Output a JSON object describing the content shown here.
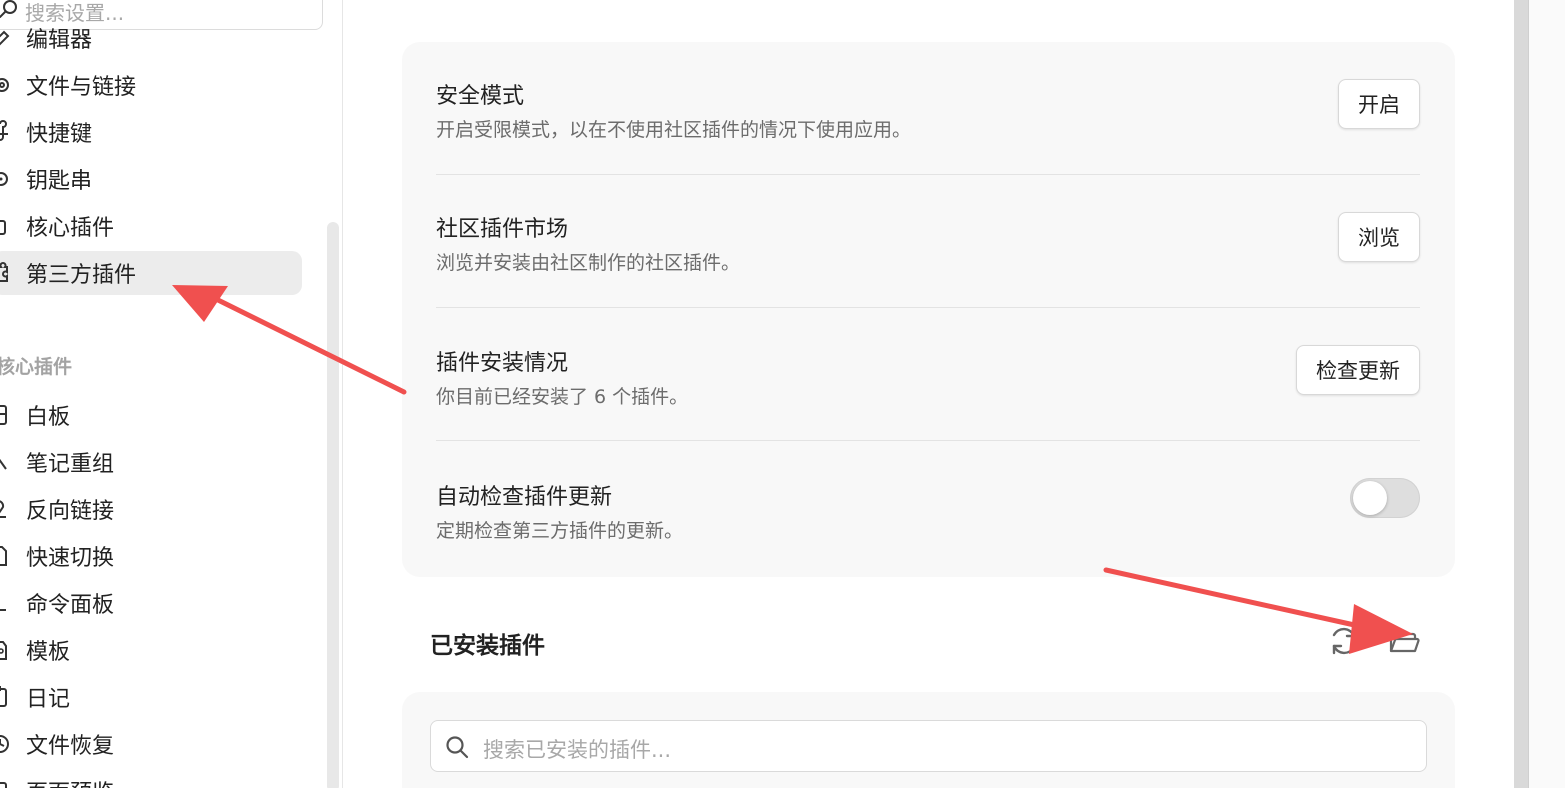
{
  "sidebar": {
    "search_placeholder": "搜索设置...",
    "items": [
      {
        "label": "编辑器",
        "icon": "pencil-icon"
      },
      {
        "label": "文件与链接",
        "icon": "gear-icon"
      },
      {
        "label": "快捷键",
        "icon": "command-icon"
      },
      {
        "label": "钥匙串",
        "icon": "key-icon"
      },
      {
        "label": "核心插件",
        "icon": "plug-icon"
      },
      {
        "label": "第三方插件",
        "icon": "puzzle-icon",
        "active": true
      }
    ],
    "section_title": "核心插件",
    "core_items": [
      {
        "label": "白板",
        "icon": "canvas-icon"
      },
      {
        "label": "笔记重组",
        "icon": "scissors-icon"
      },
      {
        "label": "反向链接",
        "icon": "backlink-icon"
      },
      {
        "label": "快速切换",
        "icon": "file-switch-icon"
      },
      {
        "label": "命令面板",
        "icon": "terminal-icon"
      },
      {
        "label": "模板",
        "icon": "template-icon"
      },
      {
        "label": "日记",
        "icon": "calendar-icon"
      },
      {
        "label": "文件恢复",
        "icon": "history-icon"
      },
      {
        "label": "页面预览",
        "icon": "preview-icon"
      }
    ]
  },
  "settings": {
    "restricted_mode": {
      "title": "安全模式",
      "desc": "开启受限模式，以在不使用社区插件的情况下使用应用。",
      "button": "开启"
    },
    "community_market": {
      "title": "社区插件市场",
      "desc": "浏览并安装由社区制作的社区插件。",
      "button": "浏览"
    },
    "installed_status": {
      "title": "插件安装情况",
      "desc": "你目前已经安装了 6 个插件。",
      "button": "检查更新"
    },
    "auto_update": {
      "title": "自动检查插件更新",
      "desc": "定期检查第三方插件的更新。",
      "enabled": false
    }
  },
  "installed": {
    "heading": "已安装插件",
    "search_placeholder": "搜索已安装的插件...",
    "refresh_icon": "refresh-icon",
    "folder_icon": "folder-open-icon"
  },
  "colors": {
    "annotation_arrow": "#f0504f",
    "active_item_bg": "#ececec",
    "card_bg": "#f8f8f8"
  }
}
